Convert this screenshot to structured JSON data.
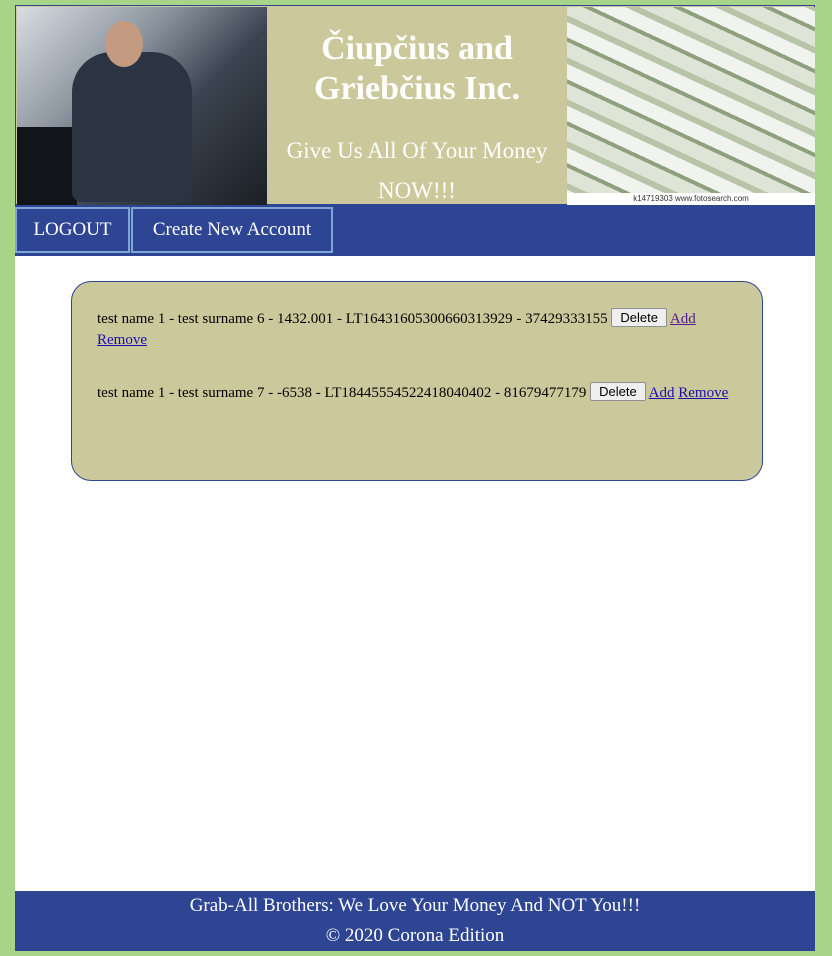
{
  "header": {
    "title_line1": "Čiupčius and",
    "title_line2": "Griebčius Inc.",
    "slogan_line1": "Give Us All Of Your Money",
    "slogan_line2": "NOW!!!",
    "image_credit": "k14719303  www.fotosearch.com"
  },
  "nav": {
    "logout": "LOGOUT",
    "create": "Create New Account"
  },
  "accounts": [
    {
      "text": "test name 1 - test surname 6 - 1432.001 - LT16431605300660313929 - 37429333155",
      "delete": "Delete",
      "add": "Add",
      "remove": "Remove"
    },
    {
      "text": "test name 1 - test surname 7 - -6538 - LT18445554522418040402 - 81679477179",
      "delete": "Delete",
      "add": "Add",
      "remove": "Remove"
    }
  ],
  "footer": {
    "line1": "Grab-All Brothers: We Love Your Money And NOT You!!!",
    "line2": "© 2020 Corona Edition"
  },
  "colors": {
    "page_bg": "#a8d48a",
    "navy": "#2e4593",
    "khaki": "#cbc99b"
  }
}
